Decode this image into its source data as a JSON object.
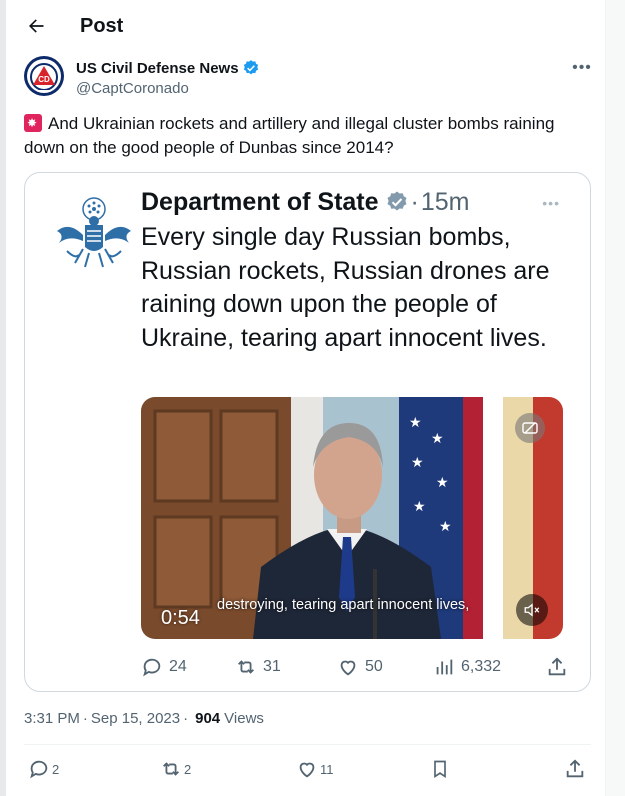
{
  "header": {
    "title": "Post"
  },
  "author": {
    "display_name": "US Civil Defense News",
    "handle": "@CaptCoronado",
    "avatar_text": "CD"
  },
  "tweet": {
    "text": "And Ukrainian rockets and artillery and illegal cluster bombs raining down on the good people of Dunbas since 2014?"
  },
  "quoted": {
    "name": "Department of State",
    "time": "15m",
    "text": "Every single day Russian bombs, Russian rockets, Russian drones are raining down upon the people of Ukraine, tearing apart innocent lives.",
    "video": {
      "timer": "0:54",
      "caption": "destroying, tearing apart innocent lives,"
    },
    "stats": {
      "replies": "24",
      "reposts": "31",
      "likes": "50",
      "views": "6,332"
    }
  },
  "meta": {
    "time": "3:31 PM",
    "date": "Sep 15, 2023",
    "views_count": "904",
    "views_label": "Views"
  },
  "actions": {
    "replies": "2",
    "reposts": "2",
    "likes": "11"
  },
  "colors": {
    "accent": "#1d9bf0",
    "text": "#0f1419",
    "muted": "#536471",
    "border": "#cfd9de",
    "siren": "#e0245e"
  }
}
